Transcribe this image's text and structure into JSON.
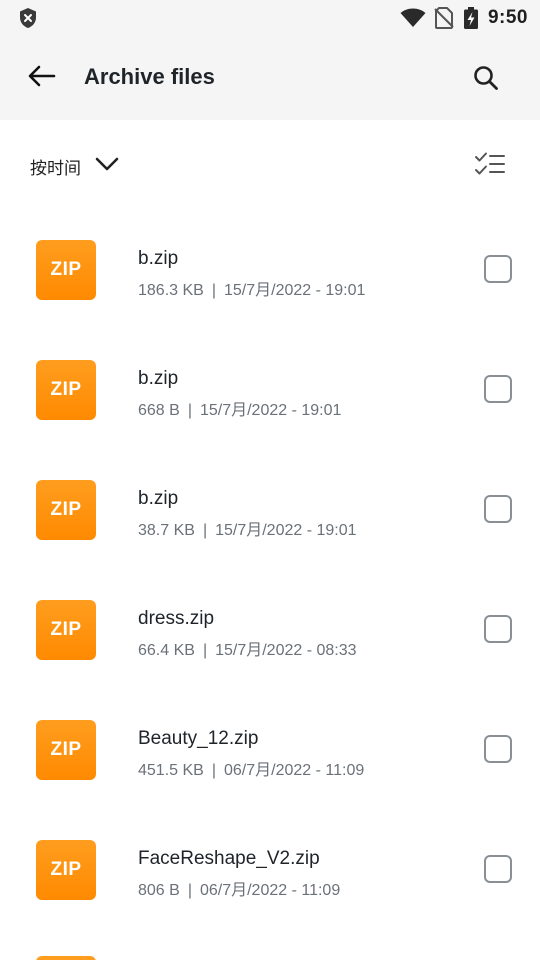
{
  "status_bar": {
    "time": "9:50",
    "icons": [
      "shield-x-icon",
      "wifi-icon",
      "no-sim-icon",
      "battery-charging-icon"
    ]
  },
  "app_bar": {
    "title": "Archive files",
    "back_icon": "arrow-left-icon",
    "search_icon": "search-icon"
  },
  "sort_bar": {
    "label": "按时间",
    "chevron_icon": "chevron-down-icon",
    "multi_select_icon": "checklist-icon"
  },
  "file_list": [
    {
      "icon_label": "ZIP",
      "name": "b.zip",
      "size": "186.3 KB",
      "date": "15/7月/2022 - 19:01",
      "checked": false
    },
    {
      "icon_label": "ZIP",
      "name": "b.zip",
      "size": "668 B",
      "date": "15/7月/2022 - 19:01",
      "checked": false
    },
    {
      "icon_label": "ZIP",
      "name": "b.zip",
      "size": "38.7 KB",
      "date": "15/7月/2022 - 19:01",
      "checked": false
    },
    {
      "icon_label": "ZIP",
      "name": "dress.zip",
      "size": "66.4 KB",
      "date": "15/7月/2022 - 08:33",
      "checked": false
    },
    {
      "icon_label": "ZIP",
      "name": "Beauty_12.zip",
      "size": "451.5 KB",
      "date": "06/7月/2022 - 11:09",
      "checked": false
    },
    {
      "icon_label": "ZIP",
      "name": "FaceReshape_V2.zip",
      "size": "806 B",
      "date": "06/7月/2022 - 11:09",
      "checked": false
    }
  ],
  "meta_separator": "|",
  "colors": {
    "zip_icon": "#ff9000",
    "header_bg": "#f5f5f5",
    "text_primary": "#1f2429",
    "text_secondary": "#6b7178"
  }
}
